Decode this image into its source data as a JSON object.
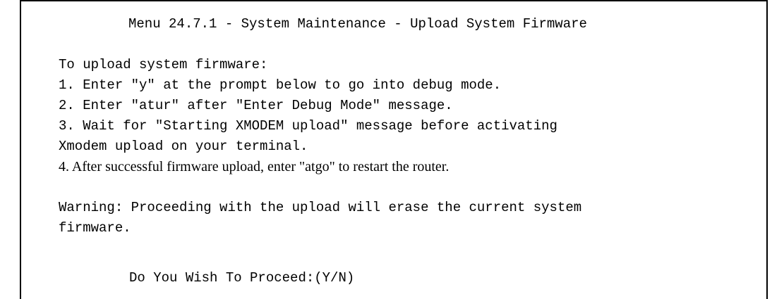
{
  "screen": {
    "title": "Menu 24.7.1 - System Maintenance - Upload System Firmware",
    "intro": "To upload system firmware:",
    "steps": [
      "1. Enter \"y\" at the prompt below to go into debug mode.",
      "2. Enter \"atur\" after \"Enter Debug Mode\" message.",
      "3. Wait for \"Starting XMODEM upload\" message before activating",
      "Xmodem upload on your terminal.",
      "4. After successful firmware upload, enter \"atgo\" to restart the router."
    ],
    "warning_line1": "Warning: Proceeding with the upload will erase the current system",
    "warning_line2": "firmware.",
    "prompt": "Do You Wish To Proceed:(Y/N)"
  }
}
